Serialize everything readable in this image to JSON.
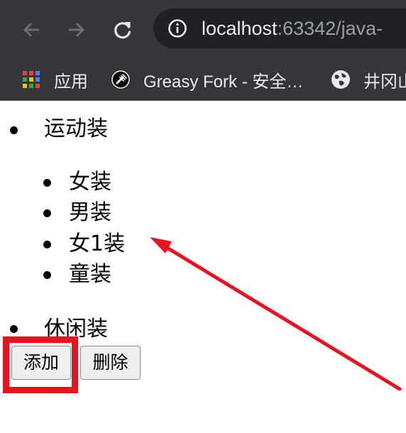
{
  "browser": {
    "url_host": "localhost",
    "url_path": ":63342/java-",
    "icons": {
      "back": "back-arrow-icon",
      "forward": "forward-arrow-icon",
      "reload": "reload-icon",
      "info": "info-icon"
    },
    "bookmarks": [
      {
        "label": "应用",
        "icon": "apps-grid-icon"
      },
      {
        "label": "Greasy Fork - 安全…",
        "icon": "greasy-fork-icon"
      },
      {
        "label": "井冈山",
        "icon": "globe-icon"
      }
    ]
  },
  "page": {
    "list": [
      {
        "label": "运动装"
      },
      {
        "label": "女装"
      },
      {
        "label": "男装"
      },
      {
        "label": "女1装"
      },
      {
        "label": "童装"
      },
      {
        "label": "休闲装"
      }
    ],
    "buttons": {
      "add_label": "添加",
      "delete_label": "删除"
    }
  },
  "annotation": {
    "color": "#e8131f"
  }
}
